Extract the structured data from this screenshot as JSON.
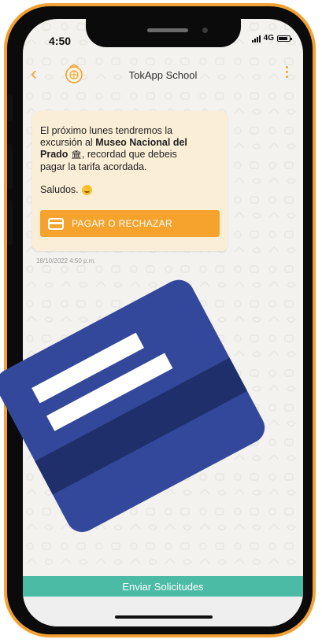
{
  "status_bar": {
    "time": "4:50",
    "network": "4G"
  },
  "header": {
    "title": "TokApp School"
  },
  "message": {
    "line1": "El próximo lunes tendremos la",
    "line2_pre": "excursión al ",
    "line2_bold": "Museo Nacional del",
    "line3_bold": "Prado",
    "line3_post": ", recordad que debeis",
    "line4": "pagar la tarifa acordada.",
    "greeting": "Saludos.",
    "button_label": "PAGAR O RECHAZAR",
    "timestamp": "18/10/2022 4:50 p.m."
  },
  "footer": {
    "send_label": "Enviar Solicitudes"
  },
  "colors": {
    "frame": "#f2a234",
    "bubble": "#fbeed6",
    "button": "#f6a32d",
    "send_bar": "#4bbba6",
    "card": "#33489a"
  },
  "icons": {
    "back": "chevron-left-icon",
    "logo": "school-logo-icon",
    "menu": "kebab-icon",
    "museum": "museum-icon",
    "emoji": "smile-emoji-icon",
    "card": "credit-card-icon"
  }
}
